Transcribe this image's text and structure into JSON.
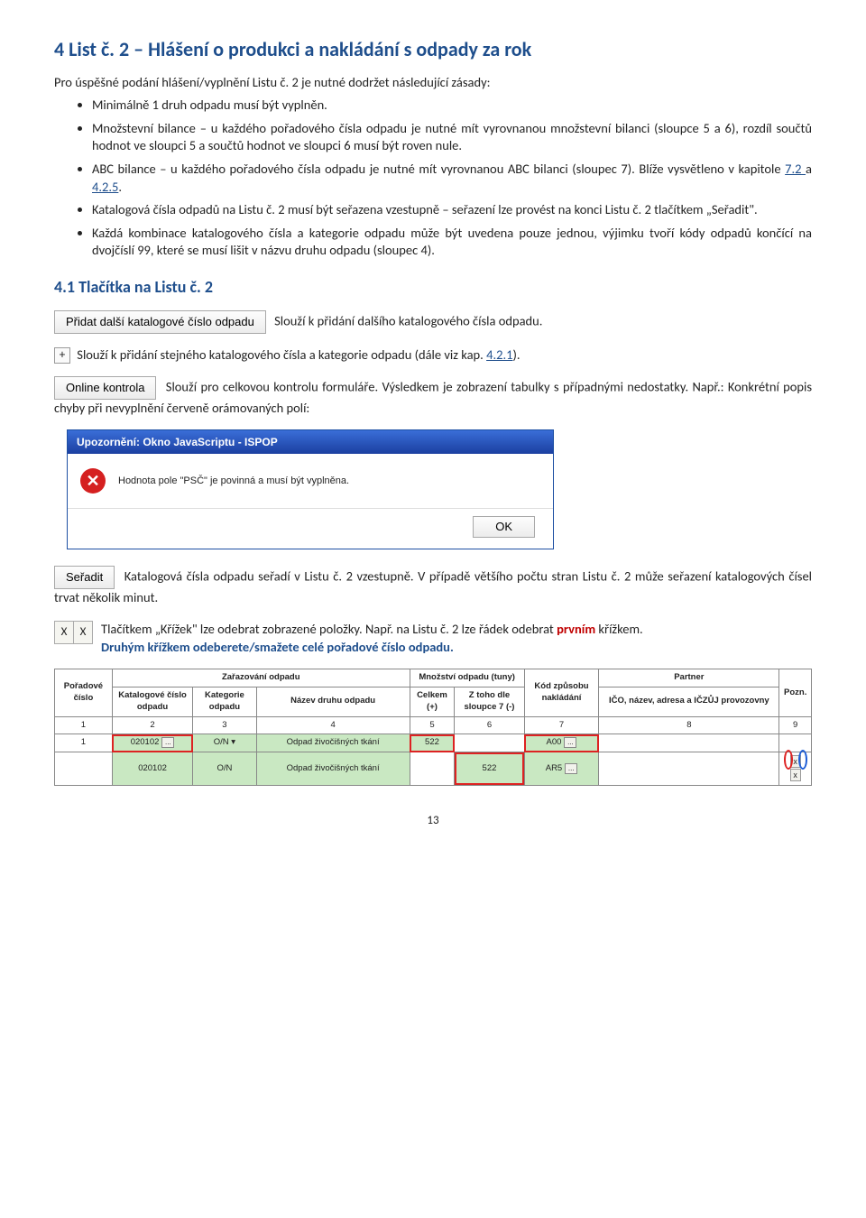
{
  "heading": "4   List č. 2 – Hlášení o produkci a nakládání s odpady za rok",
  "intro": "Pro úspěšné podání hlášení/vyplnění Listu č. 2 je nutné dodržet následující zásady:",
  "bullets": {
    "b1": "Minimálně 1 druh odpadu musí být vyplněn.",
    "b2": "Množstevní bilance – u každého pořadového čísla odpadu je nutné mít vyrovnanou množstevní bilanci (sloupce 5 a 6), rozdíl součtů hodnot ve sloupci 5 a součtů hodnot ve sloupci 6 musí být roven nule.",
    "b3_a": "ABC bilance – u každého pořadového čísla odpadu je nutné mít vyrovnanou ABC bilanci (sloupec 7). Blíže vysvětleno v kapitole ",
    "b3_link1": "7.2 ",
    "b3_mid": "a ",
    "b3_link2": "4.2.5",
    "b3_end": ".",
    "b4": "Katalogová čísla odpadů na Listu č. 2 musí být seřazena vzestupně – seřazení lze provést na konci Listu č. 2 tlačítkem „Seřadit\".",
    "b5": "Každá kombinace katalogového čísla a kategorie odpadu může být uvedena pouze jednou, výjimku tvoří kódy odpadů končící na dvojčíslí 99, které se musí lišit v názvu druhu odpadu (sloupec 4)."
  },
  "heading2": "4.1   Tlačítka na Listu č. 2",
  "btn_add": "Přidat další katalogové číslo odpadu",
  "btn_add_desc": "Slouží k přidání dalšího katalogového čísla odpadu.",
  "plus": "+",
  "plus_desc_a": " Slouží k přidání stejného katalogového čísla a kategorie odpadu (dále viz kap. ",
  "plus_link": "4.2.1",
  "plus_desc_b": ").",
  "btn_online": "Online kontrola",
  "online_desc_a": "Slouží pro celkovou kontrolu formuláře. Výsledkem je zobrazení tabulky s případnými nedostatky. Např.: Konkrétní popis chyby při nevyplnění červeně orámovaných polí:",
  "dialog": {
    "title": "Upozornění: Okno JavaScriptu - ISPOP",
    "msg": "Hodnota pole \"PSČ\" je povinná a musí být vyplněna.",
    "ok": "OK"
  },
  "btn_sort": "Seřadit",
  "sort_desc": "Katalogová čísla odpadu seřadí v Listu č. 2 vzestupně. V případě většího počtu stran Listu č. 2 může seřazení katalogových čísel trvat několik minut.",
  "x_label": "X",
  "x_desc_a": "Tlačítkem „Křížek\" lze odebrat zobrazené položky. Např. na Listu č. 2 lze řádek odebrat ",
  "x_desc_red": "prvním",
  "x_desc_b": " křížkem. ",
  "x_desc_blue": "Druhým křížkem odeberete/smažete celé pořadové číslo odpadu.",
  "table": {
    "h_porad": "Pořadové číslo",
    "h_zar": "Zařazování odpadu",
    "h_mnoz": "Množství odpadu (tuny)",
    "h_kod": "Kód způsobu nakládání",
    "h_partner": "Partner",
    "h_pozn": "Pozn.",
    "h_kat": "Katalogové číslo odpadu",
    "h_kateg": "Kategorie odpadu",
    "h_nazev": "Název druhu odpadu",
    "h_celkem": "Celkem (+)",
    "h_ztoho": "Z toho dle sloupce 7 (-)",
    "h_ico": "IČO, název, adresa a IČZŮJ provozovny",
    "n1": "1",
    "n2": "2",
    "n3": "3",
    "n4": "4",
    "n5": "5",
    "n6": "6",
    "n7": "7",
    "n8": "8",
    "n9": "9",
    "r1_por": "1",
    "r1_kat": "020102",
    "r1_kateg": "O/N",
    "r1_nazev": "Odpad živočišných tkání",
    "r1_cel": "522",
    "r1_kod": "A00",
    "r2_kat": "020102",
    "r2_kateg": "O/N",
    "r2_nazev": "Odpad živočišných tkání",
    "r2_ztoho": "522",
    "r2_kod": "AR5",
    "dots": "...",
    "chev": "▾",
    "x": "x"
  },
  "page": "13"
}
